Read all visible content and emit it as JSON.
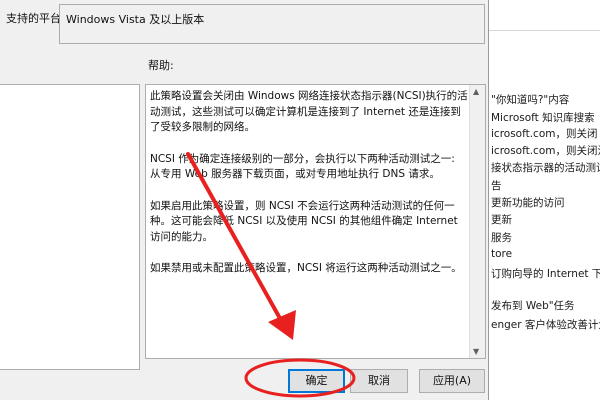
{
  "dialog": {
    "platform_label": "支持的平台:",
    "platform_value": "Windows Vista 及以上版本",
    "help_label": "帮助:",
    "help_paragraphs": [
      "此策略设置会关闭由 Windows 网络连接状态指示器(NCSI)执行的活动测试，这些测试可以确定计算机是连接到了 Internet 还是连接到了受较多限制的网络。",
      "NCSI 作为确定连接级别的一部分，会执行以下两种活动测试之一: 从专用 Web 服务器下载页面，或对专用地址执行 DNS 请求。",
      "如果启用此策略设置，则 NCSI 不会运行这两种活动测试的任何一种。这可能会降低 NCSI 以及使用 NCSI 的其他组件确定 Internet 访问的能力。",
      "如果禁用或未配置此策略设置，NCSI 将运行这两种活动测试之一。"
    ],
    "buttons": {
      "ok": "确定",
      "cancel": "取消",
      "apply": "应用(A)"
    }
  },
  "background_list": {
    "items": [
      "\"你知道吗?\"内容",
      "Microsoft 知识库搜索",
      "icrosoft.com，则关闭 In",
      "icrosoft.com，则关闭注",
      "接状态指示器的活动测试",
      "告",
      "更新功能的访问",
      "更新",
      "服务",
      "tore",
      "订购向导的 Internet 下载",
      "发布到 Web\"任务",
      "enger 客户体验改善计划"
    ]
  },
  "annotations": {
    "arrow_color": "#e8201f",
    "circle_color": "#e8201f"
  }
}
